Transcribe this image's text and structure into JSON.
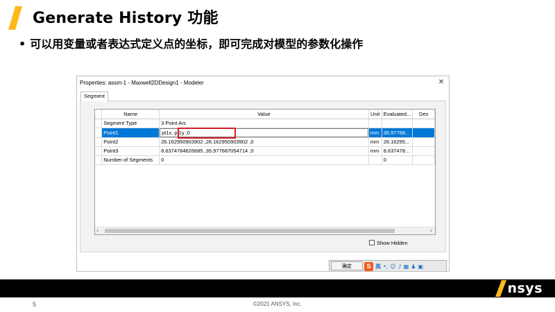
{
  "slide": {
    "title": "Generate History 功能",
    "bullet": "可以用变量或者表达式定义点的坐标，即可完成对模型的参数化操作",
    "accent_color": "#ffb81c",
    "page_number": "5",
    "copyright": "©2021 ANSYS, Inc.",
    "logo_text": "nsys"
  },
  "dialog": {
    "title": "Properties: assm-1 - Maxwell2DDesign1 - Modeler",
    "close_icon": "close-icon",
    "tab": "Segment",
    "columns": [
      "Name",
      "Value",
      "Unit",
      "Evaluated...",
      "Des"
    ],
    "rows": [
      {
        "name": "Segment Type",
        "value": "3 Point Arc",
        "unit": "",
        "evaluated": ""
      },
      {
        "name": "Point1",
        "value": "pt1x, pt1y ,0",
        "unit": "mm",
        "evaluated": "35.97768..."
      },
      {
        "name": "Point2",
        "value": "26.162950903902 ,26.162950903902 ,0",
        "unit": "mm",
        "evaluated": "26.16295..."
      },
      {
        "name": "Point3",
        "value": "8.6374784626685 ,35.977687054714 ,0",
        "unit": "mm",
        "evaluated": "8.637478..."
      },
      {
        "name": "Number of Segments",
        "value": "0",
        "unit": "",
        "evaluated": "0"
      }
    ],
    "selected_row": "Point1",
    "show_hidden_label": "Show Hidden",
    "show_hidden_checked": false,
    "ok_label": "确定",
    "ime_label": "英",
    "selection_color": "#0078d7",
    "highlight_color": "#d21f2a"
  }
}
